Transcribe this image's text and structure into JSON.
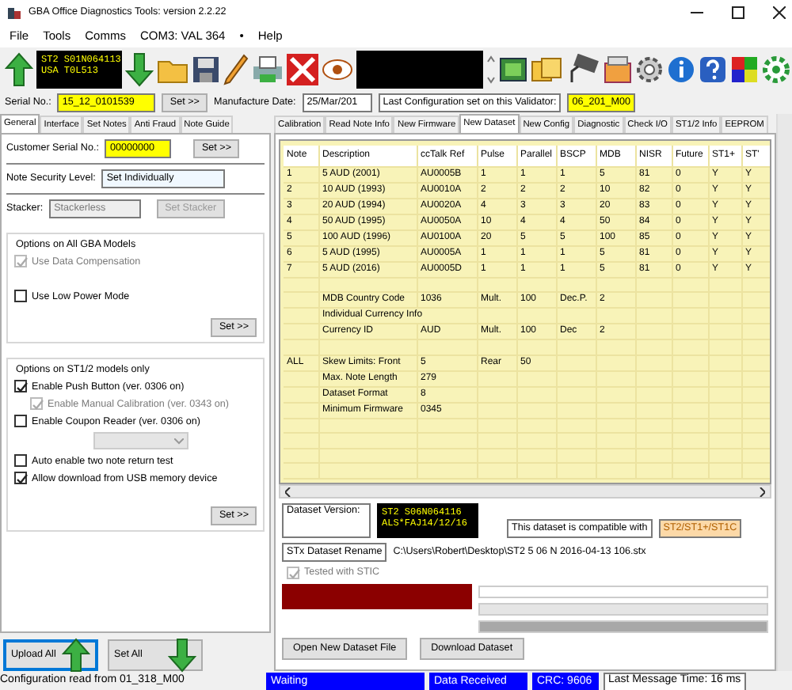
{
  "window": {
    "title": "GBA Office Diagnostics Tools: version 2.2.22"
  },
  "menu": [
    {
      "label": "File"
    },
    {
      "label": "Tools"
    },
    {
      "label": "Comms"
    },
    {
      "label": "COM3: VAL 364"
    },
    {
      "label": "•"
    },
    {
      "label": "Help"
    }
  ],
  "toolbar": {
    "display": [
      "ST2 S01N064113",
      "USA T0L513"
    ]
  },
  "serial_row": {
    "serial_label": "Serial No.:",
    "serial_value": "15_12_0101539",
    "set_button": "Set >>",
    "manufacture_label": "Manufacture Date:",
    "manufacture_value": "25/Mar/201",
    "last_config_label": "Last Configuration set on this Validator:",
    "last_config_value": "06_201_M00"
  },
  "left_tabs": [
    {
      "label": "General",
      "selected": true
    },
    {
      "label": "Interface",
      "selected": false
    },
    {
      "label": "Set Notes",
      "selected": false
    },
    {
      "label": "Anti Fraud",
      "selected": false
    },
    {
      "label": "Note Guide",
      "selected": false
    }
  ],
  "general": {
    "customer_serial": {
      "label": "Customer Serial No.:",
      "value": "00000000",
      "button": "Set >>"
    },
    "note_security": {
      "label": "Note Security Level:",
      "value": "Set Individually"
    },
    "stacker": {
      "label": "Stacker:",
      "value": "Stackerless",
      "button": "Set Stacker",
      "disabled": true
    },
    "groups": [
      {
        "title": "Options on All GBA Models",
        "button": "Set >>",
        "options": [
          {
            "kind": "checkbox",
            "label": "Use Data Compensation",
            "checked": true,
            "disabled": true
          },
          {
            "kind": "checkbox",
            "label": "Use Low Power Mode",
            "checked": false,
            "disabled": false
          }
        ]
      },
      {
        "title": "Options on ST1/2 models only",
        "button": "Set >>",
        "options": [
          {
            "kind": "checkbox",
            "label": "Enable Push Button (ver. 0306 on)",
            "checked": true,
            "disabled": false
          },
          {
            "kind": "subcheckbox",
            "label": "Enable Manual Calibration (ver. 0343 on)",
            "checked": true,
            "disabled": true
          },
          {
            "kind": "checkbox",
            "label": "Enable Coupon Reader (ver. 0306 on)",
            "checked": false,
            "disabled": false
          },
          {
            "kind": "select",
            "disabled": true
          },
          {
            "kind": "checkbox",
            "label": "Auto enable two note return test",
            "checked": false,
            "disabled": false
          },
          {
            "kind": "checkbox",
            "label": "Allow download from USB memory device",
            "checked": true,
            "disabled": false
          }
        ]
      }
    ]
  },
  "bottom_buttons": [
    {
      "label": "Upload All",
      "kind": "upload",
      "selected": true
    },
    {
      "label": "Set All",
      "kind": "set",
      "selected": false
    }
  ],
  "right_tabs": [
    {
      "label": "Calibration",
      "selected": false
    },
    {
      "label": "Read Note Info",
      "selected": false
    },
    {
      "label": "New Firmware",
      "selected": false
    },
    {
      "label": "New Dataset",
      "selected": true
    },
    {
      "label": "New Config",
      "selected": false
    },
    {
      "label": "Diagnostic",
      "selected": false
    },
    {
      "label": "Check I/O",
      "selected": false
    },
    {
      "label": "ST1/2 Info",
      "selected": false
    },
    {
      "label": "EEPROM",
      "selected": false
    }
  ],
  "table": {
    "columns": [
      "Note",
      "Description",
      "ccTalk Ref",
      "Pulse",
      "Parallel",
      "BSCP",
      "MDB",
      "NISR",
      "Future",
      "ST1+",
      "ST'"
    ],
    "rows": [
      [
        "1",
        "5 AUD (2001)",
        "AU0005B",
        "1",
        "1",
        "1",
        "5",
        "81",
        "0",
        "Y",
        "Y"
      ],
      [
        "2",
        "10 AUD (1993)",
        "AU0010A",
        "2",
        "2",
        "2",
        "10",
        "82",
        "0",
        "Y",
        "Y"
      ],
      [
        "3",
        "20 AUD (1994)",
        "AU0020A",
        "4",
        "3",
        "3",
        "20",
        "83",
        "0",
        "Y",
        "Y"
      ],
      [
        "4",
        "50 AUD (1995)",
        "AU0050A",
        "10",
        "4",
        "4",
        "50",
        "84",
        "0",
        "Y",
        "Y"
      ],
      [
        "5",
        "100 AUD (1996)",
        "AU0100A",
        "20",
        "5",
        "5",
        "100",
        "85",
        "0",
        "Y",
        "Y"
      ],
      [
        "6",
        "5 AUD (1995)",
        "AU0005A",
        "1",
        "1",
        "1",
        "5",
        "81",
        "0",
        "Y",
        "Y"
      ],
      [
        "7",
        "5 AUD (2016)",
        "AU0005D",
        "1",
        "1",
        "1",
        "5",
        "81",
        "0",
        "Y",
        "Y"
      ]
    ],
    "info_sections": [
      [
        {
          "label": "MDB Country Code",
          "value": "1036",
          "pairs": [
            {
              "label": "Mult.",
              "value": "100"
            },
            {
              "label": "Dec.P.",
              "value": "2"
            }
          ]
        },
        {
          "label": "Individual Currency Info"
        },
        {
          "label": "Currency ID",
          "value": "AUD",
          "pairs": [
            {
              "label": "Mult.",
              "value": "100"
            },
            {
              "label": "Dec",
              "value": "2"
            }
          ]
        }
      ],
      [
        {
          "prefix": "ALL",
          "label": "Skew Limits: Front",
          "value": "5",
          "pairs": [
            {
              "label": "Rear",
              "value": "50"
            }
          ]
        },
        {
          "label": "Max. Note Length",
          "value": "279"
        },
        {
          "label": "Dataset Format",
          "value": "8"
        },
        {
          "label": "Minimum Firmware",
          "value": "0345"
        }
      ]
    ]
  },
  "dataset": {
    "version_label": "Dataset Version:",
    "display": [
      "ST2 S06N064116",
      "ALS*FAJ14/12/16"
    ],
    "compatible_label": "This dataset is compatible with",
    "compatible_value": "ST2/ST1+/ST1C",
    "rename_label": "STx Dataset Rename",
    "path": "C:\\Users\\Robert\\Desktop\\ST2 5 06 N 2016-04-13 106.stx",
    "tested": {
      "label": "Tested with STIC",
      "checked": true,
      "disabled": true
    },
    "buttons": [
      "Open New Dataset File",
      "Download Dataset"
    ],
    "progress": [
      {
        "level": 0
      },
      {
        "level": 0
      },
      {
        "level": 1
      }
    ]
  },
  "status_bar": {
    "message": "Configuration read from 01_318_M00",
    "panels": [
      "Waiting",
      "Data Received",
      "CRC: 9606"
    ],
    "last_message": "Last Message Time: 16 ms"
  }
}
